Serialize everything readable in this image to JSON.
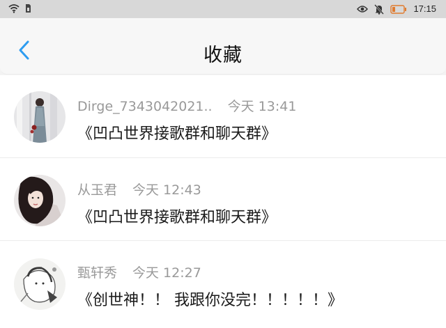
{
  "status": {
    "time": "17:15"
  },
  "header": {
    "title": "收藏"
  },
  "favorites": [
    {
      "name": "Dirge_7343042021..",
      "time": "今天 13:41",
      "content": "《凹凸世界接歌群和聊天群》"
    },
    {
      "name": "从玉君",
      "time": "今天 12:43",
      "content": "《凹凸世界接歌群和聊天群》"
    },
    {
      "name": "甄轩秀",
      "time": "今天 12:27",
      "content": "《创世神！！ 我跟你没完！！！！！》"
    }
  ],
  "colors": {
    "accent": "#2d9cf0",
    "title": "#111111",
    "meta": "#999999",
    "content": "#1a1a1a",
    "status_bar": "#d8d8d8"
  },
  "icons": [
    "wifi-icon",
    "sim-icon",
    "eye-icon",
    "mute-bell-icon",
    "battery-icon",
    "back-chevron-icon"
  ]
}
